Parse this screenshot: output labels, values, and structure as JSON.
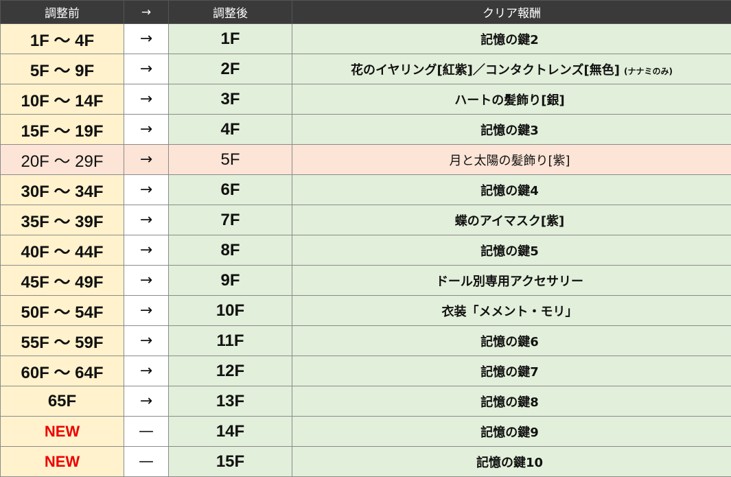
{
  "headers": {
    "before": "調整前",
    "arrow": "→",
    "after": "調整後",
    "reward": "クリア報酬"
  },
  "colors": {
    "header_bg": "#3a3a3a",
    "before_bg": "#fff2cc",
    "after_bg": "#e2efda",
    "highlight_bg": "#fce4d6",
    "new_text": "#ee0000"
  },
  "rows": [
    {
      "before": "1F ～ 4F",
      "arrow": "→",
      "after": "1F",
      "reward": "記憶の鍵2",
      "note": ""
    },
    {
      "before": "5F ～ 9F",
      "arrow": "→",
      "after": "2F",
      "reward": "花のイヤリング[紅紫]／コンタクトレンズ[無色]",
      "note": "(ナナミのみ)"
    },
    {
      "before": "10F ～ 14F",
      "arrow": "→",
      "after": "3F",
      "reward": "ハートの髪飾り[銀]",
      "note": ""
    },
    {
      "before": "15F ～ 19F",
      "arrow": "→",
      "after": "4F",
      "reward": "記憶の鍵3",
      "note": ""
    },
    {
      "before": "20F ～ 29F",
      "arrow": "→",
      "after": "5F",
      "reward": "月と太陽の髪飾り[紫]",
      "note": "",
      "highlight": true
    },
    {
      "before": "30F ～ 34F",
      "arrow": "→",
      "after": "6F",
      "reward": "記憶の鍵4",
      "note": ""
    },
    {
      "before": "35F ～ 39F",
      "arrow": "→",
      "after": "7F",
      "reward": "蝶のアイマスク[紫]",
      "note": ""
    },
    {
      "before": "40F ～ 44F",
      "arrow": "→",
      "after": "8F",
      "reward": "記憶の鍵5",
      "note": ""
    },
    {
      "before": "45F ～ 49F",
      "arrow": "→",
      "after": "9F",
      "reward": "ドール別専用アクセサリー",
      "note": ""
    },
    {
      "before": "50F ～ 54F",
      "arrow": "→",
      "after": "10F",
      "reward": "衣装「メメント・モリ」",
      "note": ""
    },
    {
      "before": "55F ～ 59F",
      "arrow": "→",
      "after": "11F",
      "reward": "記憶の鍵6",
      "note": ""
    },
    {
      "before": "60F ～ 64F",
      "arrow": "→",
      "after": "12F",
      "reward": "記憶の鍵7",
      "note": ""
    },
    {
      "before": "65F",
      "arrow": "→",
      "after": "13F",
      "reward": "記憶の鍵8",
      "note": ""
    },
    {
      "before": "NEW",
      "arrow": "—",
      "after": "14F",
      "reward": "記憶の鍵9",
      "note": "",
      "is_new": true
    },
    {
      "before": "NEW",
      "arrow": "—",
      "after": "15F",
      "reward": "記憶の鍵10",
      "note": "",
      "is_new": true
    }
  ]
}
